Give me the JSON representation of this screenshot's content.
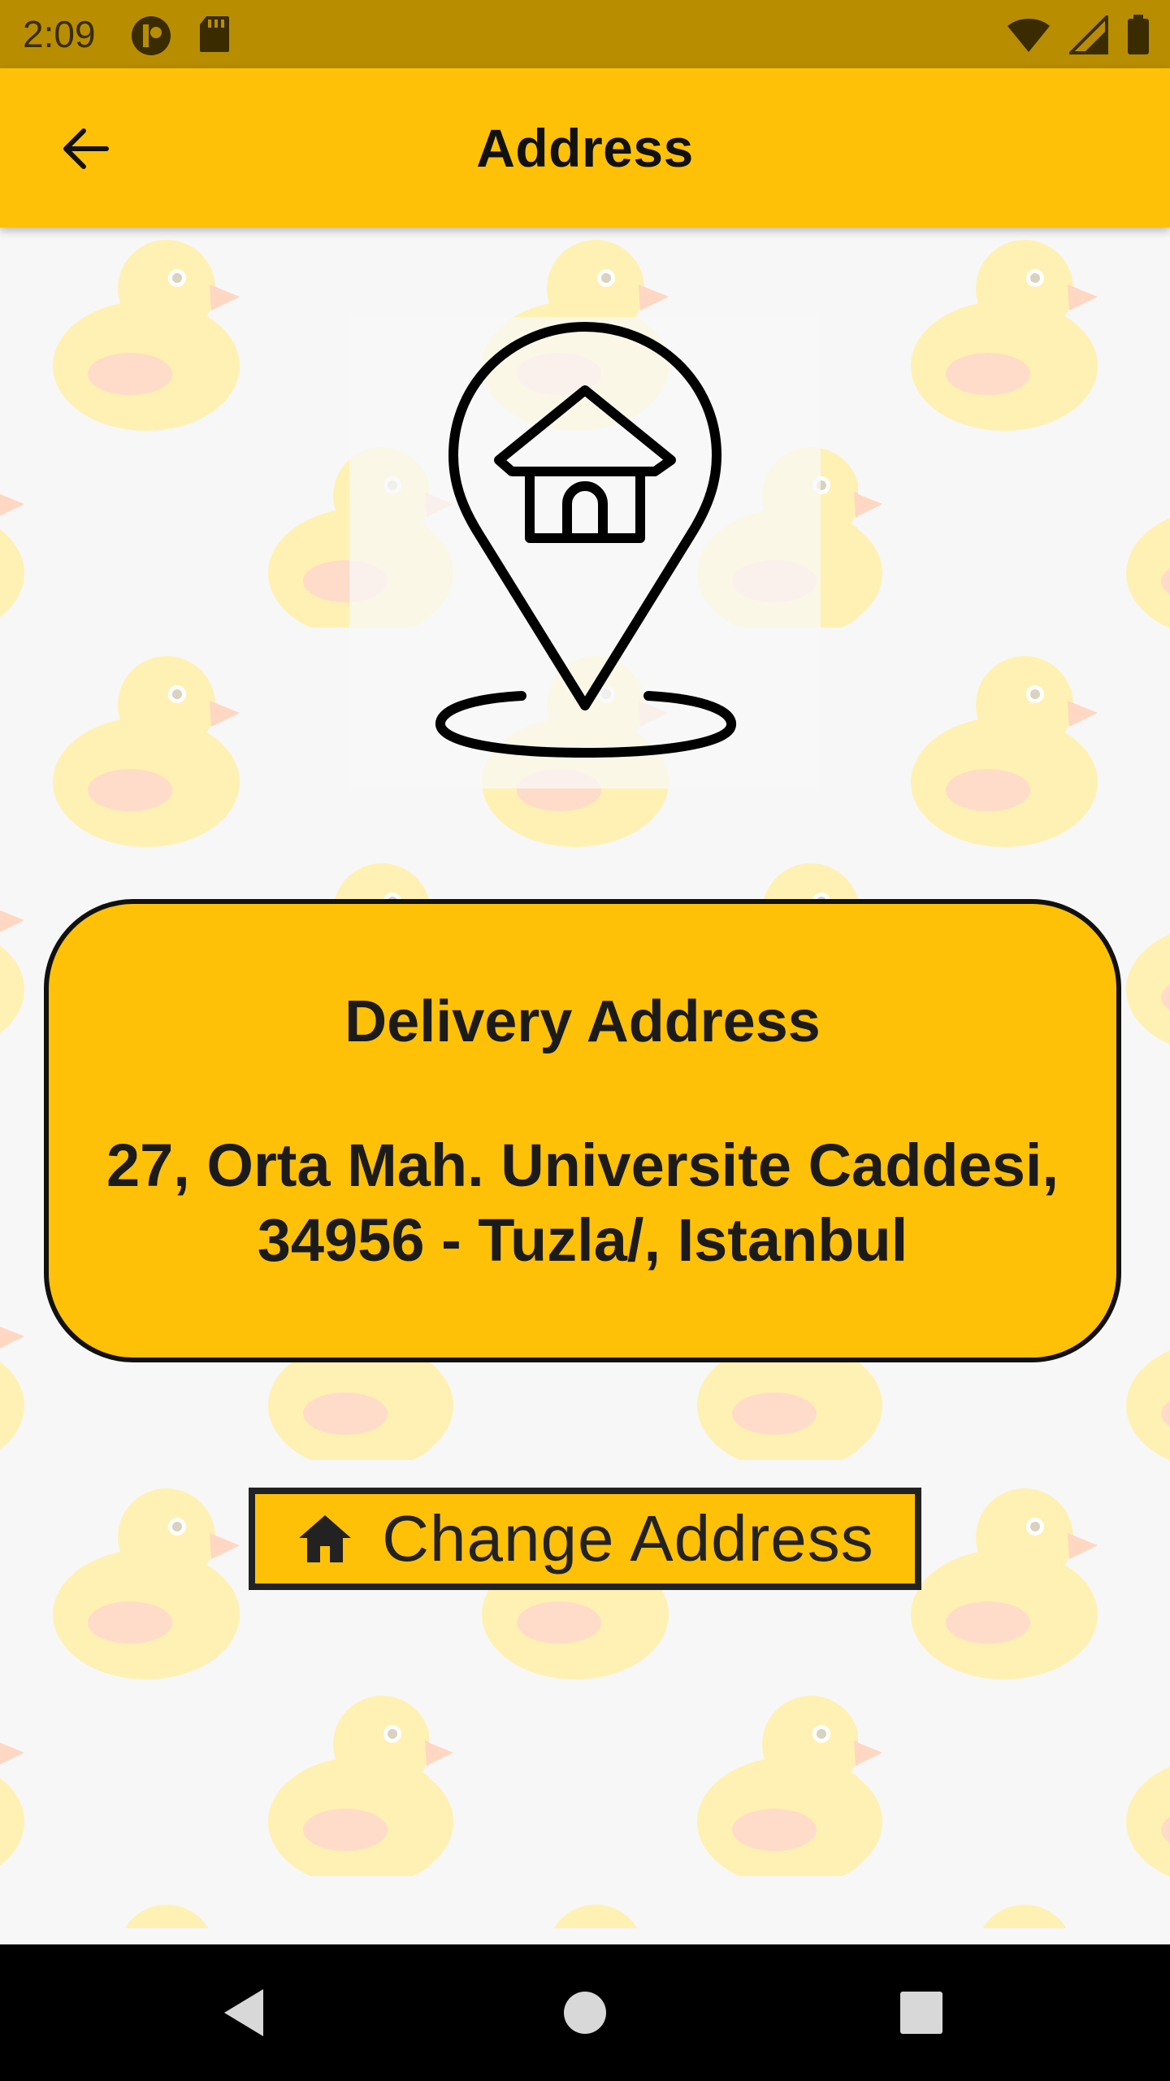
{
  "status_bar": {
    "time": "2:09",
    "left_icons": [
      "circle-app-icon",
      "sd-card-icon"
    ],
    "right_icons": [
      "wifi-icon",
      "signal-icon",
      "battery-icon"
    ]
  },
  "app_bar": {
    "title": "Address",
    "back_icon": "arrow-left-icon"
  },
  "hero": {
    "icon": "home-location-pin-icon"
  },
  "address_card": {
    "title": "Delivery Address",
    "line1": "27, Orta Mah. Universite Caddesi,",
    "line2": "34956 - Tuzla/, Istanbul"
  },
  "change_address_button": {
    "icon": "home-icon",
    "label": "Change Address"
  },
  "navigation_bar": {
    "buttons": [
      "back-triangle-icon",
      "home-circle-icon",
      "recents-square-icon"
    ]
  },
  "colors": {
    "accent": "#ffc107",
    "status_bar": "#b88e00",
    "background": "#f7f7f7",
    "text": "#111111"
  }
}
